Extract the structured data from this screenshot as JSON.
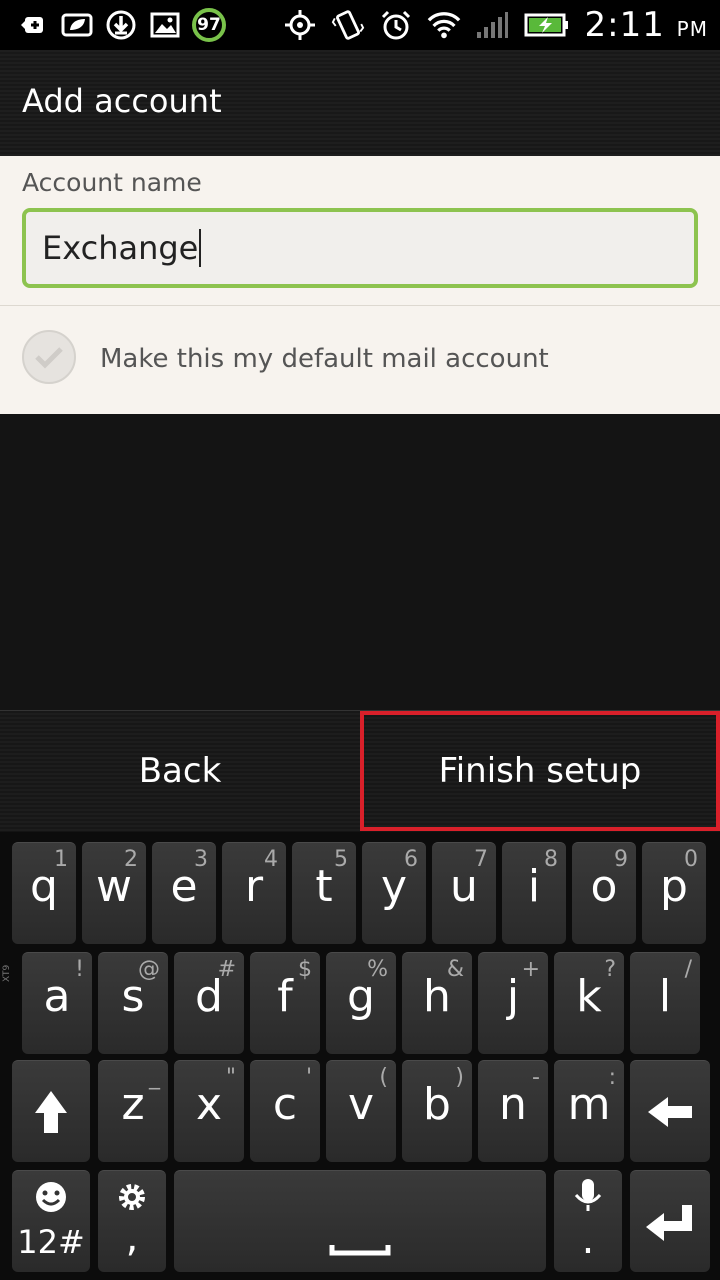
{
  "status_bar": {
    "battery_badge": "97",
    "time": "2:11",
    "ampm": "PM",
    "icons_left": [
      "back-arrow-icon",
      "leaf-icon",
      "download-icon",
      "image-icon",
      "badge-97"
    ],
    "icons_right": [
      "gps-icon",
      "vibrate-icon",
      "alarm-icon",
      "wifi-icon",
      "signal-icon",
      "battery-charging-icon"
    ]
  },
  "title_bar": {
    "title": "Add account"
  },
  "form": {
    "account_name_label": "Account name",
    "account_name_value": "Exchange",
    "default_checkbox_label": "Make this my default mail account"
  },
  "actions": {
    "back_label": "Back",
    "finish_label": "Finish setup"
  },
  "keyboard": {
    "row1": [
      {
        "key": "q",
        "alt": "1"
      },
      {
        "key": "w",
        "alt": "2"
      },
      {
        "key": "e",
        "alt": "3"
      },
      {
        "key": "r",
        "alt": "4"
      },
      {
        "key": "t",
        "alt": "5"
      },
      {
        "key": "y",
        "alt": "6"
      },
      {
        "key": "u",
        "alt": "7"
      },
      {
        "key": "i",
        "alt": "8"
      },
      {
        "key": "o",
        "alt": "9"
      },
      {
        "key": "p",
        "alt": "0"
      }
    ],
    "row2": [
      {
        "key": "a",
        "alt": "!"
      },
      {
        "key": "s",
        "alt": "@"
      },
      {
        "key": "d",
        "alt": "#"
      },
      {
        "key": "f",
        "alt": "$"
      },
      {
        "key": "g",
        "alt": "%"
      },
      {
        "key": "h",
        "alt": "&"
      },
      {
        "key": "j",
        "alt": "+"
      },
      {
        "key": "k",
        "alt": "?"
      },
      {
        "key": "l",
        "alt": "/"
      }
    ],
    "row3": [
      {
        "key": "z",
        "alt": "_"
      },
      {
        "key": "x",
        "alt": "\""
      },
      {
        "key": "c",
        "alt": "'"
      },
      {
        "key": "v",
        "alt": "("
      },
      {
        "key": "b",
        "alt": ")"
      },
      {
        "key": "n",
        "alt": "-"
      },
      {
        "key": "m",
        "alt": ":"
      }
    ],
    "numbers_key": "12#",
    "comma_key": ",",
    "period_key": ".",
    "xt9_label": "XT9"
  }
}
